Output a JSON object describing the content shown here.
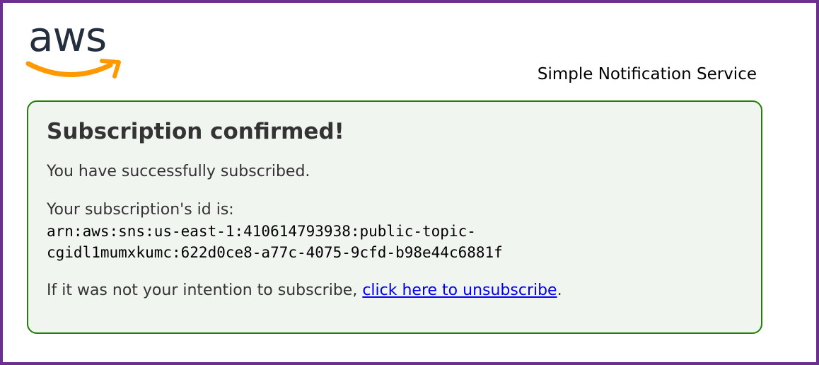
{
  "logo": {
    "text": "aws",
    "name": "aws-logo"
  },
  "header": {
    "service_name": "Simple Notification Service"
  },
  "confirmation": {
    "title": "Subscription confirmed!",
    "success_message": "You have successfully subscribed.",
    "id_label": "Your subscription's id is:",
    "arn_line1": "arn:aws:sns:us-east-1:410614793938:public-topic-",
    "arn_line2": "cgidl1mumxkumc:622d0ce8-a77c-4075-9cfd-b98e44c6881f",
    "unsubscribe_prefix": "If it was not your intention to subscribe, ",
    "unsubscribe_link": "click here to unsubscribe",
    "unsubscribe_suffix": "."
  },
  "colors": {
    "frame_border": "#6a2f8f",
    "panel_border": "#1d8102",
    "panel_background": "#f1f5f0",
    "logo_text": "#232f3e",
    "logo_smile": "#ff9900",
    "link": "#0000ee"
  }
}
